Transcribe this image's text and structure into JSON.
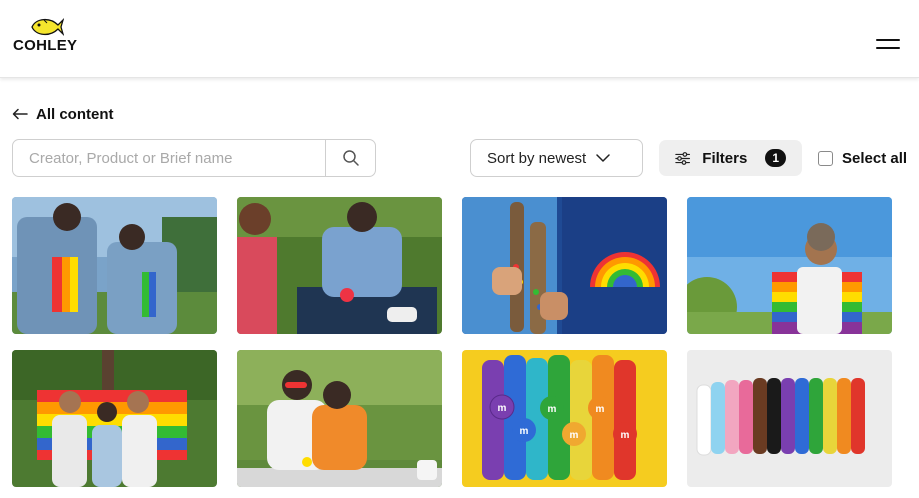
{
  "header": {
    "brand": "COHLEY",
    "logo_icon": "fish-icon",
    "menu_icon": "hamburger-menu-icon"
  },
  "nav": {
    "back_label": "All content",
    "back_icon": "arrow-left-icon"
  },
  "toolbar": {
    "search_placeholder": "Creator, Product or Brief name",
    "search_value": "",
    "search_icon": "search-icon",
    "sort_label": "Sort by newest",
    "sort_icon": "chevron-down-icon",
    "filters_label": "Filters",
    "filters_icon": "sliders-icon",
    "filters_count": "1",
    "select_all_label": "Select all",
    "select_all_checked": false
  },
  "colors": {
    "logo_yellow": "#F5E52D",
    "filters_bg": "#EFEFEF",
    "badge_bg": "#111111",
    "border": "#CFCFCF"
  },
  "gallery": {
    "items": [
      {
        "subject": "two women in denim jackets with rainbow flags in a park"
      },
      {
        "subject": "friends sitting on grass sharing candy"
      },
      {
        "subject": "pride t-shirts holding candy-filled bottles"
      },
      {
        "subject": "man with rainbow flag against blue sky"
      },
      {
        "subject": "group of friends with rainbow flag under a tree"
      },
      {
        "subject": "couple at a picnic table in a park"
      },
      {
        "subject": "rainbow rows of candy on yellow background"
      },
      {
        "subject": "rainbow rows of candy on white background"
      }
    ]
  }
}
